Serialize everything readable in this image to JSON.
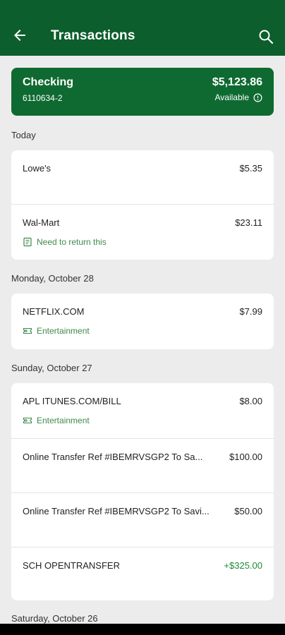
{
  "header": {
    "title": "Transactions",
    "back_icon": "arrow-left-icon",
    "search_icon": "search-icon"
  },
  "account": {
    "name": "Checking",
    "number": "6110634-2",
    "balance": "$5,123.86",
    "available_label": "Available",
    "info_icon": "info-icon",
    "color": "#0f6a31"
  },
  "colors": {
    "brand": "#0c5e2c",
    "credit": "#1e8a3a",
    "tag": "#3e8a4c",
    "background": "#ececec"
  },
  "sections": [
    {
      "date": "Today",
      "transactions": [
        {
          "merchant": "Lowe's",
          "amount": "$5.35",
          "tag": ""
        },
        {
          "merchant": "Wal-Mart",
          "amount": "$23.11",
          "tag": "Need to return this",
          "tag_icon": "note-icon"
        }
      ]
    },
    {
      "date": "Monday, October 28",
      "transactions": [
        {
          "merchant": "NETFLIX.COM",
          "amount": "$7.99",
          "tag": "Entertainment",
          "tag_icon": "ticket-icon"
        }
      ]
    },
    {
      "date": "Sunday, October 27",
      "transactions": [
        {
          "merchant": "APL ITUNES.COM/BILL",
          "amount": "$8.00",
          "tag": "Entertainment",
          "tag_icon": "ticket-icon"
        },
        {
          "merchant": "Online Transfer Ref #IBEMRVSGP2 To Sa...",
          "amount": "$100.00",
          "tag": ""
        },
        {
          "merchant": "Online Transfer Ref #IBEMRVSGP2 To Savi...",
          "amount": "$50.00",
          "tag": ""
        },
        {
          "merchant": "SCH OPENTRANSFER",
          "amount": "+$325.00",
          "tag": "",
          "credit": true
        }
      ]
    },
    {
      "date": "Saturday, October 26",
      "transactions": []
    }
  ]
}
